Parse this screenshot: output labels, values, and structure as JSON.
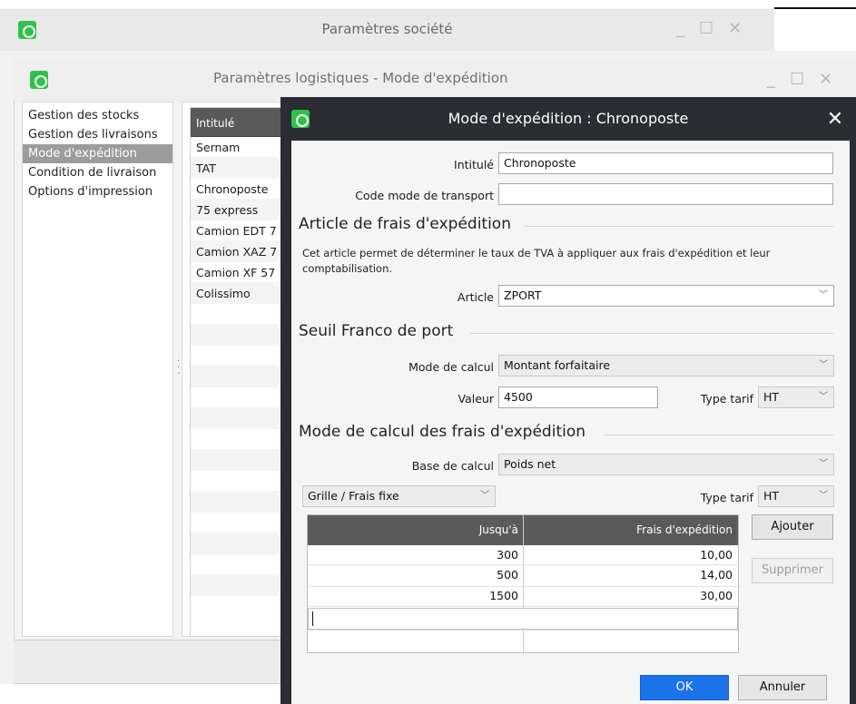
{
  "window_societe": {
    "title": "Paramètres société"
  },
  "window_logistique": {
    "title": "Paramètres logistiques - Mode d'expédition",
    "nav_items": [
      "Gestion des stocks",
      "Gestion des livraisons",
      "Mode d'expédition",
      "Condition de livraison",
      "Options d'impression"
    ],
    "selected_nav": "Mode d'expédition",
    "list_header": "Intitulé",
    "list_items": [
      "Sernam",
      "TAT",
      "Chronoposte",
      "75 express",
      "Camion EDT 7",
      "Camion XAZ 7",
      "Camion XF 57",
      "Colissimo"
    ]
  },
  "dialog": {
    "title": "Mode d'expédition : Chronoposte",
    "close_glyph": "✕",
    "intitule_label": "Intitulé",
    "intitule_value": "Chronoposte",
    "code_transport_label": "Code mode de transport",
    "code_transport_value": "",
    "section_article": "Article de frais d'expédition",
    "article_help": "Cet article permet de déterminer le taux de TVA à appliquer aux frais d'expédition et leur comptabilisation.",
    "article_label": "Article",
    "article_value": "ZPORT",
    "section_seuil": "Seuil Franco de port",
    "mode_calcul_label": "Mode de calcul",
    "mode_calcul_value": "Montant forfaitaire",
    "valeur_label": "Valeur",
    "valeur_value": "4500",
    "type_tarif_label": "Type tarif",
    "type_tarif_value": "HT",
    "section_mode_calcul": "Mode de calcul des frais d'expédition",
    "base_calcul_label": "Base de calcul",
    "base_calcul_value": "Poids net",
    "grille_value": "Grille / Frais fixe",
    "type_tarif2_label": "Type tarif",
    "type_tarif2_value": "HT",
    "grid": {
      "headers": [
        "Jusqu'à",
        "Frais d'expédition"
      ],
      "rows": [
        [
          "300",
          "10,00"
        ],
        [
          "500",
          "14,00"
        ],
        [
          "1500",
          "30,00"
        ]
      ]
    },
    "ajouter_label": "Ajouter",
    "supprimer_label": "Supprimer",
    "ok_label": "OK",
    "annuler_label": "Annuler",
    "colors": {
      "title_bar": "#2b2d33",
      "primary": "#1a73e8",
      "grid_header": "#5a5a5a",
      "app_icon": "#2fc24a"
    }
  }
}
